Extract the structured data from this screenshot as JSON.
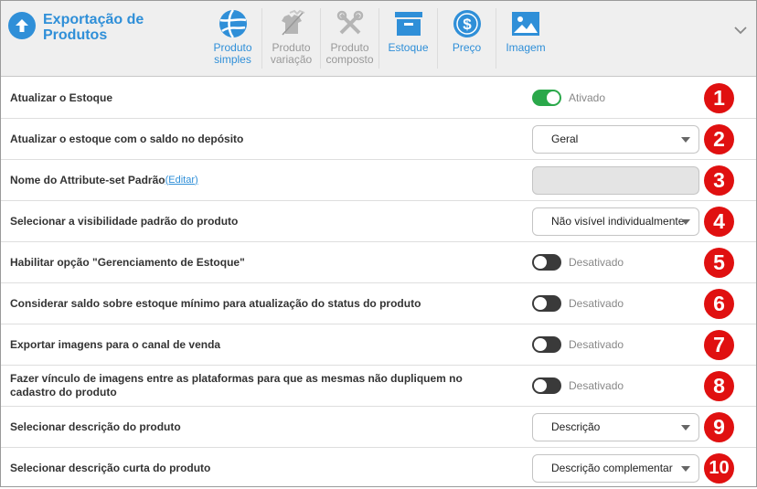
{
  "header": {
    "title_line1": "Exportação de",
    "title_line2": "Produtos",
    "tabs": [
      {
        "line1": "Produto",
        "line2": "simples",
        "icon": "beach-ball-icon",
        "state": "active"
      },
      {
        "line1": "Produto",
        "line2": "variação",
        "icon": "shirts-disabled-icon",
        "state": "disabled"
      },
      {
        "line1": "Produto",
        "line2": "composto",
        "icon": "tools-disabled-icon",
        "state": "disabled"
      },
      {
        "line1": "Estoque",
        "line2": "",
        "icon": "box-icon",
        "state": "active"
      },
      {
        "line1": "Preço",
        "line2": "",
        "icon": "dollar-icon",
        "state": "active"
      },
      {
        "line1": "Imagem",
        "line2": "",
        "icon": "image-icon",
        "state": "active"
      }
    ]
  },
  "colors": {
    "accent": "#2f8fd8",
    "toggle_on": "#2aa84a",
    "toggle_off": "#3a3a3a",
    "badge": "#e01010"
  },
  "rows": [
    {
      "label": "Atualizar o Estoque",
      "type": "toggle",
      "on": true,
      "state_text": "Ativado",
      "badge": "1"
    },
    {
      "label": "Atualizar o estoque com o saldo no depósito",
      "type": "select",
      "value": "Geral",
      "badge": "2"
    },
    {
      "label": "Nome do Attribute-set Padrão",
      "edit_link": "(Editar)",
      "type": "input",
      "value": "",
      "badge": "3"
    },
    {
      "label": "Selecionar a visibilidade padrão do produto",
      "type": "select",
      "value": "Não visível individualmente",
      "badge": "4"
    },
    {
      "label": "Habilitar opção \"Gerenciamento de Estoque\"",
      "type": "toggle",
      "on": false,
      "state_text": "Desativado",
      "badge": "5"
    },
    {
      "label": "Considerar saldo sobre estoque mínimo para atualização do status do produto",
      "type": "toggle",
      "on": false,
      "state_text": "Desativado",
      "badge": "6"
    },
    {
      "label": "Exportar imagens para o canal de venda",
      "type": "toggle",
      "on": false,
      "state_text": "Desativado",
      "badge": "7"
    },
    {
      "label": "Fazer vínculo de imagens entre as plataformas para que as mesmas não dupliquem no cadastro do produto",
      "type": "toggle",
      "on": false,
      "state_text": "Desativado",
      "badge": "8"
    },
    {
      "label": "Selecionar descrição do produto",
      "type": "select",
      "value": "Descrição",
      "badge": "9"
    },
    {
      "label": "Selecionar descrição curta do produto",
      "type": "select",
      "value": "Descrição complementar",
      "badge": "10"
    }
  ]
}
